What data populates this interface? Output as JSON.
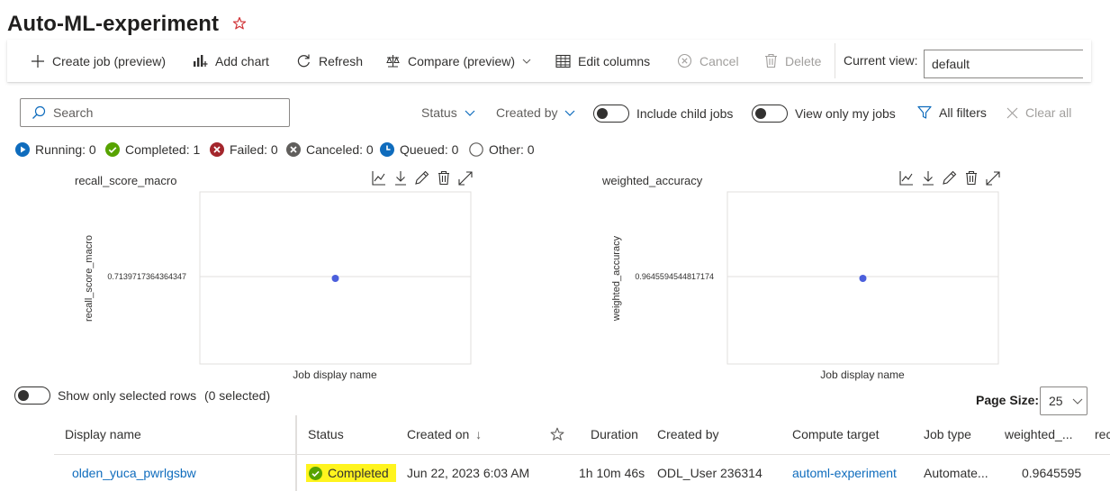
{
  "title": "Auto-ML-experiment",
  "toolbar": {
    "create_job": "Create job (preview)",
    "add_chart": "Add chart",
    "refresh": "Refresh",
    "compare": "Compare (preview)",
    "edit_columns": "Edit columns",
    "cancel": "Cancel",
    "delete": "Delete",
    "current_view_label": "Current view:",
    "current_view_value": "default"
  },
  "filters": {
    "search_placeholder": "Search",
    "status": "Status",
    "created_by": "Created by",
    "include_child_jobs": "Include child jobs",
    "view_only_my_jobs": "View only my jobs",
    "all_filters": "All filters",
    "clear_all": "Clear all"
  },
  "status_summary": [
    {
      "label": "Running: 0",
      "color": "#0f6cbd",
      "icon": "play-circle-icon"
    },
    {
      "label": "Completed: 1",
      "color": "#57a300",
      "icon": "check-circle-icon"
    },
    {
      "label": "Failed: 0",
      "color": "#a4262c",
      "icon": "x-circle-icon"
    },
    {
      "label": "Canceled: 0",
      "color": "#605e5c",
      "icon": "x-circle-icon"
    },
    {
      "label": "Queued: 0",
      "color": "#0f6cbd",
      "icon": "clock-circle-icon"
    },
    {
      "label": "Other: 0",
      "color": "#605e5c",
      "icon": "empty-circle-icon"
    }
  ],
  "chart_data": [
    {
      "type": "scatter",
      "title": "recall_score_macro",
      "ylabel": "recall_score_macro",
      "xlabel": "Job display name",
      "y_tick": "0.7139717364364347",
      "points": [
        {
          "x": "olden_yuca_pwrlgsbw",
          "y": 0.7139717364364347
        }
      ],
      "point_color": "#4b5fdc"
    },
    {
      "type": "scatter",
      "title": "weighted_accuracy",
      "ylabel": "weighted_accuracy",
      "xlabel": "Job display name",
      "y_tick": "0.9645594544817174",
      "points": [
        {
          "x": "olden_yuca_pwrlgsbw",
          "y": 0.9645594544817174
        }
      ],
      "point_color": "#4b5fdc"
    }
  ],
  "selection": {
    "label": "Show only selected rows",
    "count": "(0 selected)"
  },
  "paging": {
    "label": "Page Size:",
    "value": "25"
  },
  "table": {
    "columns": [
      "Display name",
      "Status",
      "Created on",
      "Duration",
      "Created by",
      "Compute target",
      "Job type",
      "weighted_...",
      "rec"
    ],
    "sort_indicator": "↓",
    "rows": [
      {
        "display_name": "olden_yuca_pwrlgsbw",
        "status": "Completed",
        "created_on": "Jun 22, 2023 6:03 AM",
        "duration": "1h 10m 46s",
        "created_by": "ODL_User 236314",
        "compute_target": "automl-experiment",
        "job_type": "Automate...",
        "weighted_accuracy": "0.9645595"
      }
    ]
  }
}
